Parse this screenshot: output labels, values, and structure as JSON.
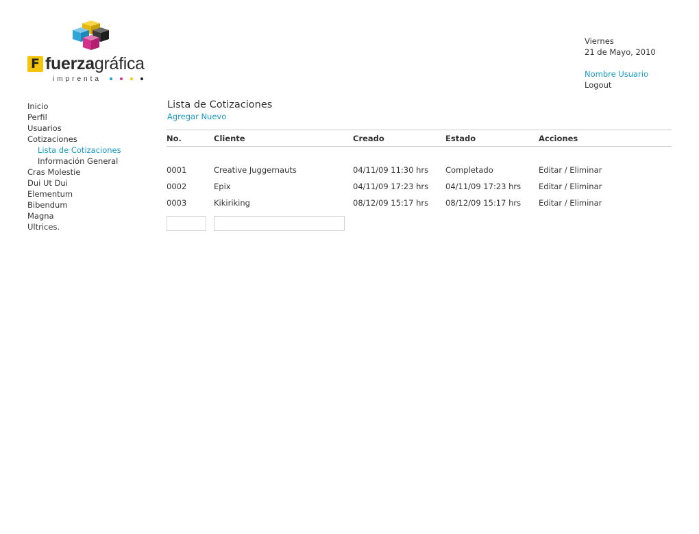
{
  "brand": {
    "logo_letter": "F",
    "name_bold": "fuerza",
    "name_regular": "gráfica",
    "tagline": "imprenta",
    "dot_colors": [
      "#1b9bc4",
      "#d4318c",
      "#f4c40f",
      "#222222"
    ]
  },
  "header": {
    "day": "Viernes",
    "date": "21 de Mayo, 2010",
    "username": "Nombre Usuario",
    "logout": "Logout"
  },
  "sidebar": {
    "items": [
      {
        "label": "Inicio"
      },
      {
        "label": "Perfil"
      },
      {
        "label": "Usuarios"
      },
      {
        "label": "Cotizaciones"
      },
      {
        "label": "Lista de Cotizaciones",
        "active": true,
        "sub": true
      },
      {
        "label": "Información General",
        "sub": true
      },
      {
        "label": "Cras Molestie"
      },
      {
        "label": "Dui Ut Dui"
      },
      {
        "label": "Elementum"
      },
      {
        "label": "Bibendum"
      },
      {
        "label": "Magna"
      },
      {
        "label": "Ultrices."
      }
    ]
  },
  "main": {
    "title": "Lista de Cotizaciones",
    "add_new": "Agregar Nuevo",
    "table": {
      "headers": {
        "no": "No.",
        "cliente": "Cliente",
        "creado": "Creado",
        "estado": "Estado",
        "acciones": "Acciones"
      },
      "rows": [
        {
          "no": "0001",
          "cliente": "Creative Juggernauts",
          "creado": "04/11/09  11:30 hrs",
          "estado": "Completado",
          "editar": "Editar",
          "sep": "/",
          "eliminar": "Eliminar"
        },
        {
          "no": "0002",
          "cliente": "Epix",
          "creado": "04/11/09  17:23 hrs",
          "estado": "04/11/09  17:23 hrs",
          "editar": "Editar",
          "sep": "/",
          "eliminar": "Eliminar"
        },
        {
          "no": "0003",
          "cliente": "Kikiriking",
          "creado": "08/12/09  15:17 hrs",
          "estado": "08/12/09  15:17 hrs",
          "editar": "Editar",
          "sep": "/",
          "eliminar": "Eliminar"
        }
      ],
      "filter_no": {
        "value": "",
        "placeholder": ""
      },
      "filter_cliente": {
        "value": "",
        "placeholder": ""
      }
    }
  },
  "colors": {
    "link": "#1b9bc4",
    "text": "#333333",
    "rule": "#c9c9c9"
  }
}
